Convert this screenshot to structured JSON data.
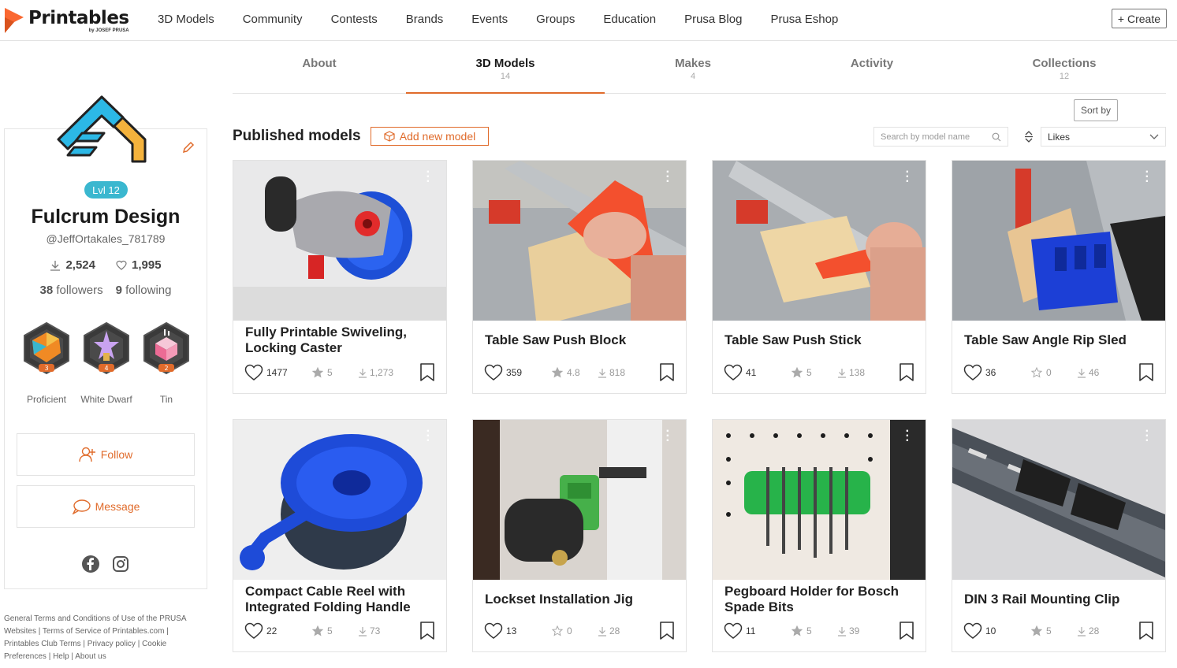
{
  "brand": {
    "name": "Printables",
    "sub": "by JOSEF PRUSA"
  },
  "nav": [
    "3D Models",
    "Community",
    "Contests",
    "Brands",
    "Events",
    "Groups",
    "Education",
    "Prusa Blog",
    "Prusa Eshop"
  ],
  "create_label": "+ Create",
  "profile": {
    "level": "Lvl 12",
    "name": "Fulcrum Design",
    "handle": "@JeffOrtakales_781789",
    "downloads": "2,524",
    "likes": "1,995",
    "followers_count": "38",
    "followers_label": "followers",
    "following_count": "9",
    "following_label": "following",
    "badges": [
      {
        "label": "Proficient",
        "level": "3"
      },
      {
        "label": "White Dwarf",
        "level": "4"
      },
      {
        "label": "Tin",
        "level": "2"
      }
    ],
    "follow_label": "Follow",
    "message_label": "Message"
  },
  "footer_text": "General Terms and Conditions of Use of the PRUSA Websites | Terms of Service of Printables.com | Printables Club Terms | Privacy policy | Cookie Preferences | Help | About us",
  "tabs": [
    {
      "label": "About",
      "count": ""
    },
    {
      "label": "3D Models",
      "count": "14"
    },
    {
      "label": "Makes",
      "count": "4"
    },
    {
      "label": "Activity",
      "count": ""
    },
    {
      "label": "Collections",
      "count": "12"
    }
  ],
  "section": {
    "title": "Published models",
    "add_label": "Add new model",
    "search_placeholder": "Search by model name",
    "sort_tooltip": "Sort by",
    "sort_value": "Likes"
  },
  "models": [
    {
      "title": "Fully Printable Swiveling, Locking Caster",
      "likes": "1477",
      "rating": "5",
      "downloads": "1,273"
    },
    {
      "title": "Table Saw Push Block",
      "likes": "359",
      "rating": "4.8",
      "downloads": "818"
    },
    {
      "title": "Table Saw Push Stick",
      "likes": "41",
      "rating": "5",
      "downloads": "138"
    },
    {
      "title": "Table Saw Angle Rip Sled",
      "likes": "36",
      "rating": "0",
      "downloads": "46"
    },
    {
      "title": "Compact Cable Reel with Integrated Folding Handle",
      "likes": "22",
      "rating": "5",
      "downloads": "73"
    },
    {
      "title": "Lockset Installation Jig",
      "likes": "13",
      "rating": "0",
      "downloads": "28"
    },
    {
      "title": "Pegboard Holder for Bosch Spade Bits",
      "likes": "11",
      "rating": "5",
      "downloads": "39"
    },
    {
      "title": "DIN 3 Rail Mounting Clip",
      "likes": "10",
      "rating": "5",
      "downloads": "28"
    }
  ],
  "colors": {
    "accent": "#e06b2b",
    "level": "#3ab7cf"
  }
}
